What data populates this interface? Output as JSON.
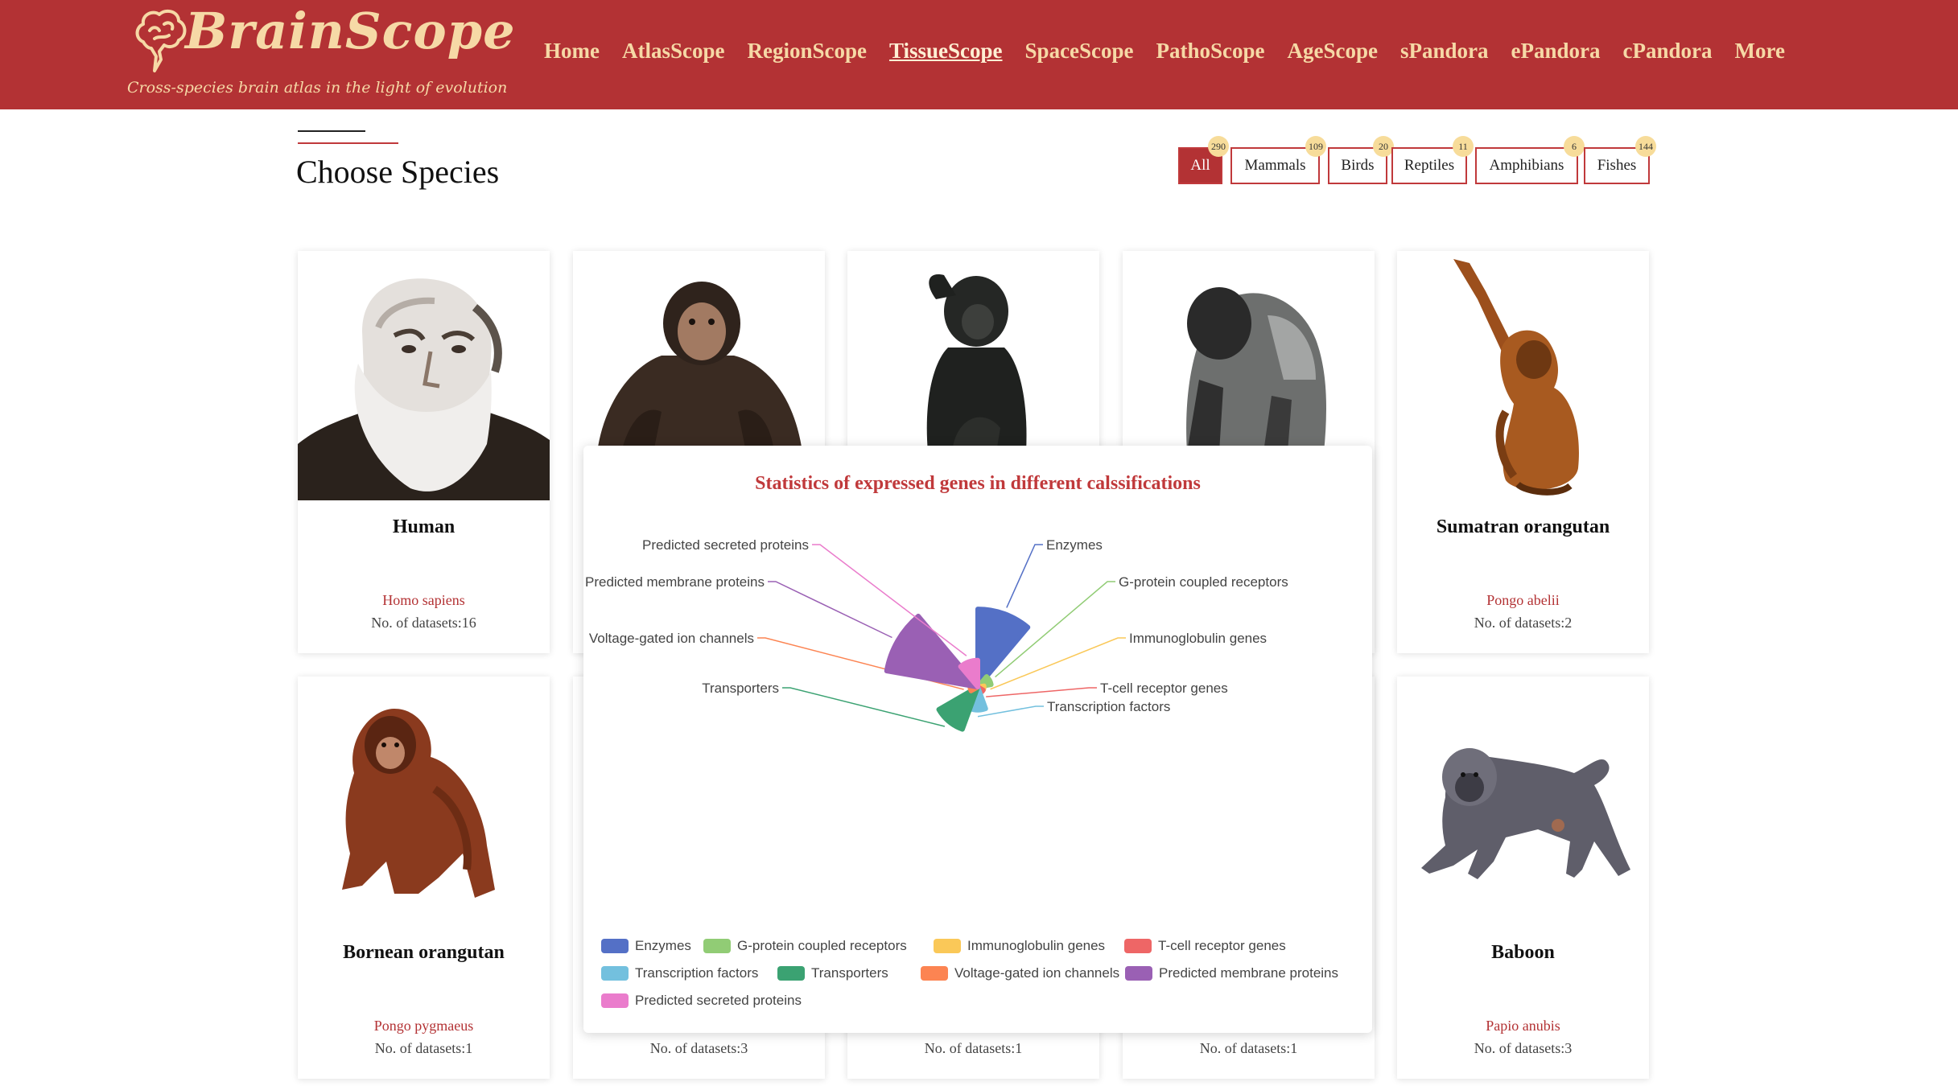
{
  "header": {
    "brand": "BrainScope",
    "tagline": "Cross-species brain atlas in the light of evolution",
    "nav": [
      "Home",
      "AtlasScope",
      "RegionScope",
      "TissueScope",
      "SpaceScope",
      "PathoScope",
      "AgeScope",
      "sPandora",
      "ePandora",
      "cPandora",
      "More"
    ],
    "active_nav": "TissueScope"
  },
  "section": {
    "title": "Choose Species"
  },
  "filters": [
    {
      "label": "All",
      "count": "290",
      "active": true
    },
    {
      "label": "Mammals",
      "count": "109",
      "active": false
    },
    {
      "label": "Birds",
      "count": "20",
      "active": false
    },
    {
      "label": "Reptiles",
      "count": "11",
      "active": false
    },
    {
      "label": "Amphibians",
      "count": "6",
      "active": false
    },
    {
      "label": "Fishes",
      "count": "144",
      "active": false
    }
  ],
  "cards": [
    {
      "name": "Human",
      "latin": "Homo sapiens",
      "datasets": "No. of datasets:16",
      "image": "human-portrait"
    },
    {
      "name": "",
      "latin": "",
      "datasets": "",
      "image": "chimpanzee"
    },
    {
      "name": "",
      "latin": "",
      "datasets": "",
      "image": "bonobo"
    },
    {
      "name": "",
      "latin": "",
      "datasets": "",
      "image": "gorilla"
    },
    {
      "name": "Sumatran orangutan",
      "latin": "Pongo abelii",
      "datasets": "No. of datasets:2",
      "image": "sumatran-orangutan"
    },
    {
      "name": "Bornean orangutan",
      "latin": "Pongo pygmaeus",
      "datasets": "No. of datasets:1",
      "image": "bornean-orangutan"
    },
    {
      "name": "",
      "latin": "",
      "datasets": "No. of datasets:3",
      "image": ""
    },
    {
      "name": "",
      "latin": "",
      "datasets": "No. of datasets:1",
      "image": ""
    },
    {
      "name": "",
      "latin": "",
      "datasets": "No. of datasets:1",
      "image": ""
    },
    {
      "name": "Baboon",
      "latin": "Papio anubis",
      "datasets": "No. of datasets:3",
      "image": "baboon"
    }
  ],
  "popup": {
    "title": "Statistics of expressed genes in different calssifications"
  },
  "colors": {
    "header": "#b33234",
    "accent": "#c0393b",
    "logo": "#f6d9a6",
    "badge": "#f7dc9a"
  },
  "chart_data": {
    "type": "pie",
    "subtype": "rose",
    "title": "Statistics of expressed genes in different calssifications",
    "series": [
      {
        "name": "Enzymes",
        "value": 100,
        "color": "#5470c6"
      },
      {
        "name": "G-protein coupled receptors",
        "value": 12,
        "color": "#91cc75"
      },
      {
        "name": "Immunoglobulin genes",
        "value": 2,
        "color": "#fac858"
      },
      {
        "name": "T-cell receptor genes",
        "value": 2,
        "color": "#ee6666"
      },
      {
        "name": "Transcription factors",
        "value": 25,
        "color": "#73c0de"
      },
      {
        "name": "Transporters",
        "value": 55,
        "color": "#3ba272"
      },
      {
        "name": "Voltage-gated ion channels",
        "value": 4,
        "color": "#fc8452"
      },
      {
        "name": "Predicted membrane proteins",
        "value": 120,
        "color": "#9a60b4"
      },
      {
        "name": "Predicted secreted proteins",
        "value": 30,
        "color": "#ea7ccc"
      }
    ],
    "legend_position": "bottom"
  }
}
